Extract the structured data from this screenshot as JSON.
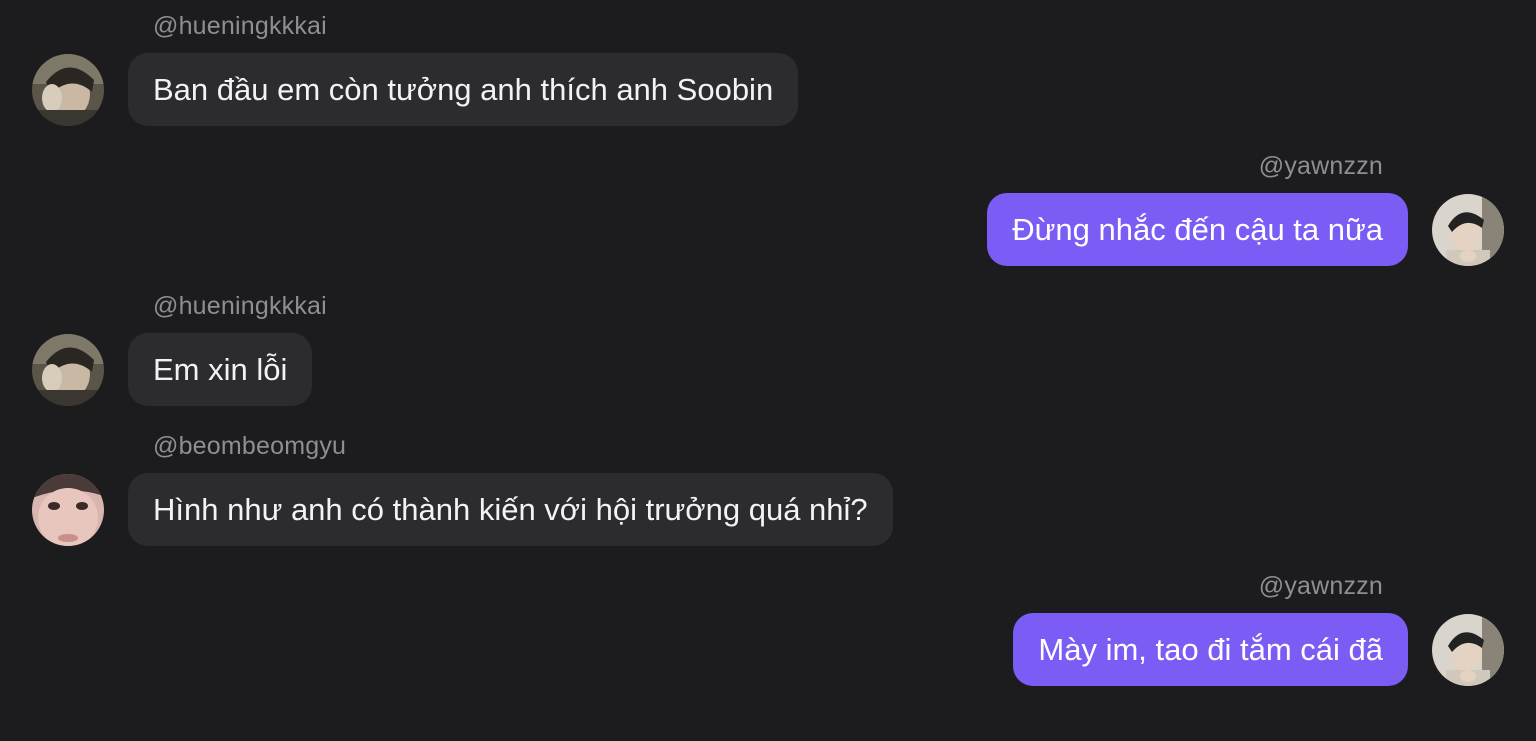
{
  "colors": {
    "background": "#1c1c1e",
    "incoming_bubble": "#2c2c2e",
    "outgoing_bubble": "#7b5cf5",
    "username_text": "#8e8e93"
  },
  "messages": [
    {
      "direction": "incoming",
      "username": "@hueningkkkai",
      "text": "Ban đầu em còn tưởng anh thích anh Soobin",
      "avatar": "hueningkai-avatar"
    },
    {
      "direction": "outgoing",
      "username": "@yawnzzn",
      "text": "Đừng nhắc đến cậu ta nữa",
      "avatar": "yawnzzn-avatar"
    },
    {
      "direction": "incoming",
      "username": "@hueningkkkai",
      "text": "Em xin lỗi",
      "avatar": "hueningkai-avatar"
    },
    {
      "direction": "incoming",
      "username": "@beombeomgyu",
      "text": "Hình như anh có thành kiến với hội trưởng quá nhỉ?",
      "avatar": "beombeomgyu-avatar"
    },
    {
      "direction": "outgoing",
      "username": "@yawnzzn",
      "text": "Mày im, tao đi tắm cái đã",
      "avatar": "yawnzzn-avatar"
    }
  ]
}
